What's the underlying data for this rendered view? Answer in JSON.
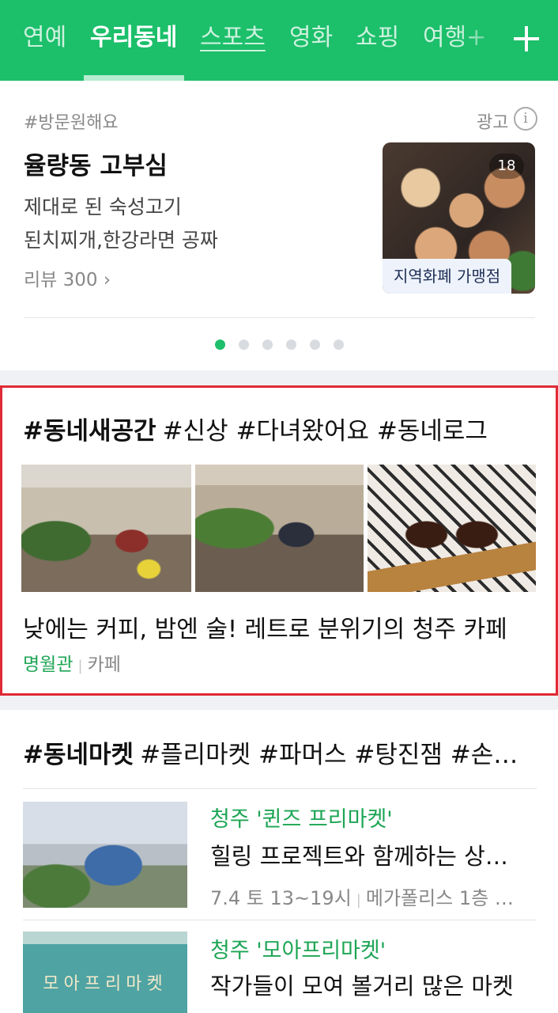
{
  "tabs": [
    {
      "label": "연예",
      "active": false
    },
    {
      "label": "우리동네",
      "active": true
    },
    {
      "label": "스포츠",
      "active": false
    },
    {
      "label": "영화",
      "active": false
    },
    {
      "label": "쇼핑",
      "active": false
    },
    {
      "label": "여행+",
      "active": false
    }
  ],
  "colors": {
    "brand": "#1cbf6a",
    "highlight_border": "#e02a35",
    "link_green": "#1da554"
  },
  "ad": {
    "tag": "#방문원해요",
    "ad_label": "광고",
    "info_icon": "i",
    "title": "율량동 고부심",
    "desc_line1": "제대로 된 숙성고기",
    "desc_line2": "된치찌개,한강라면 공짜",
    "review": "리뷰 300",
    "review_chevron": "›",
    "photo_count": "18",
    "photo_badge": "지역화폐 가맹점",
    "carousel_total": 6,
    "carousel_active": 1
  },
  "space": {
    "title_main": "#동네새공간",
    "title_tags": "#신상 #다녀왔어요 #동네로그",
    "headline": "낮에는 커피, 밤엔 술! 레트로 분위기의 청주 카페",
    "place": "명월관",
    "separator": "|",
    "category": "카페"
  },
  "market": {
    "title_main": "#동네마켓",
    "title_tags": "#플리마켓 #파머스 #탕진잼 #손…",
    "items": [
      {
        "name": "청주 '퀸즈 프리마켓'",
        "desc": "힐링 프로젝트와 함께하는 상…",
        "date": "7.4 토 13~19시",
        "separator": "|",
        "place": "메가폴리스 1층 …"
      },
      {
        "name": "청주 '모아프리마켓'",
        "desc": "작가들이 모여 볼거리 많은 마켓",
        "thumb_text": "모아프리마켓"
      }
    ]
  }
}
